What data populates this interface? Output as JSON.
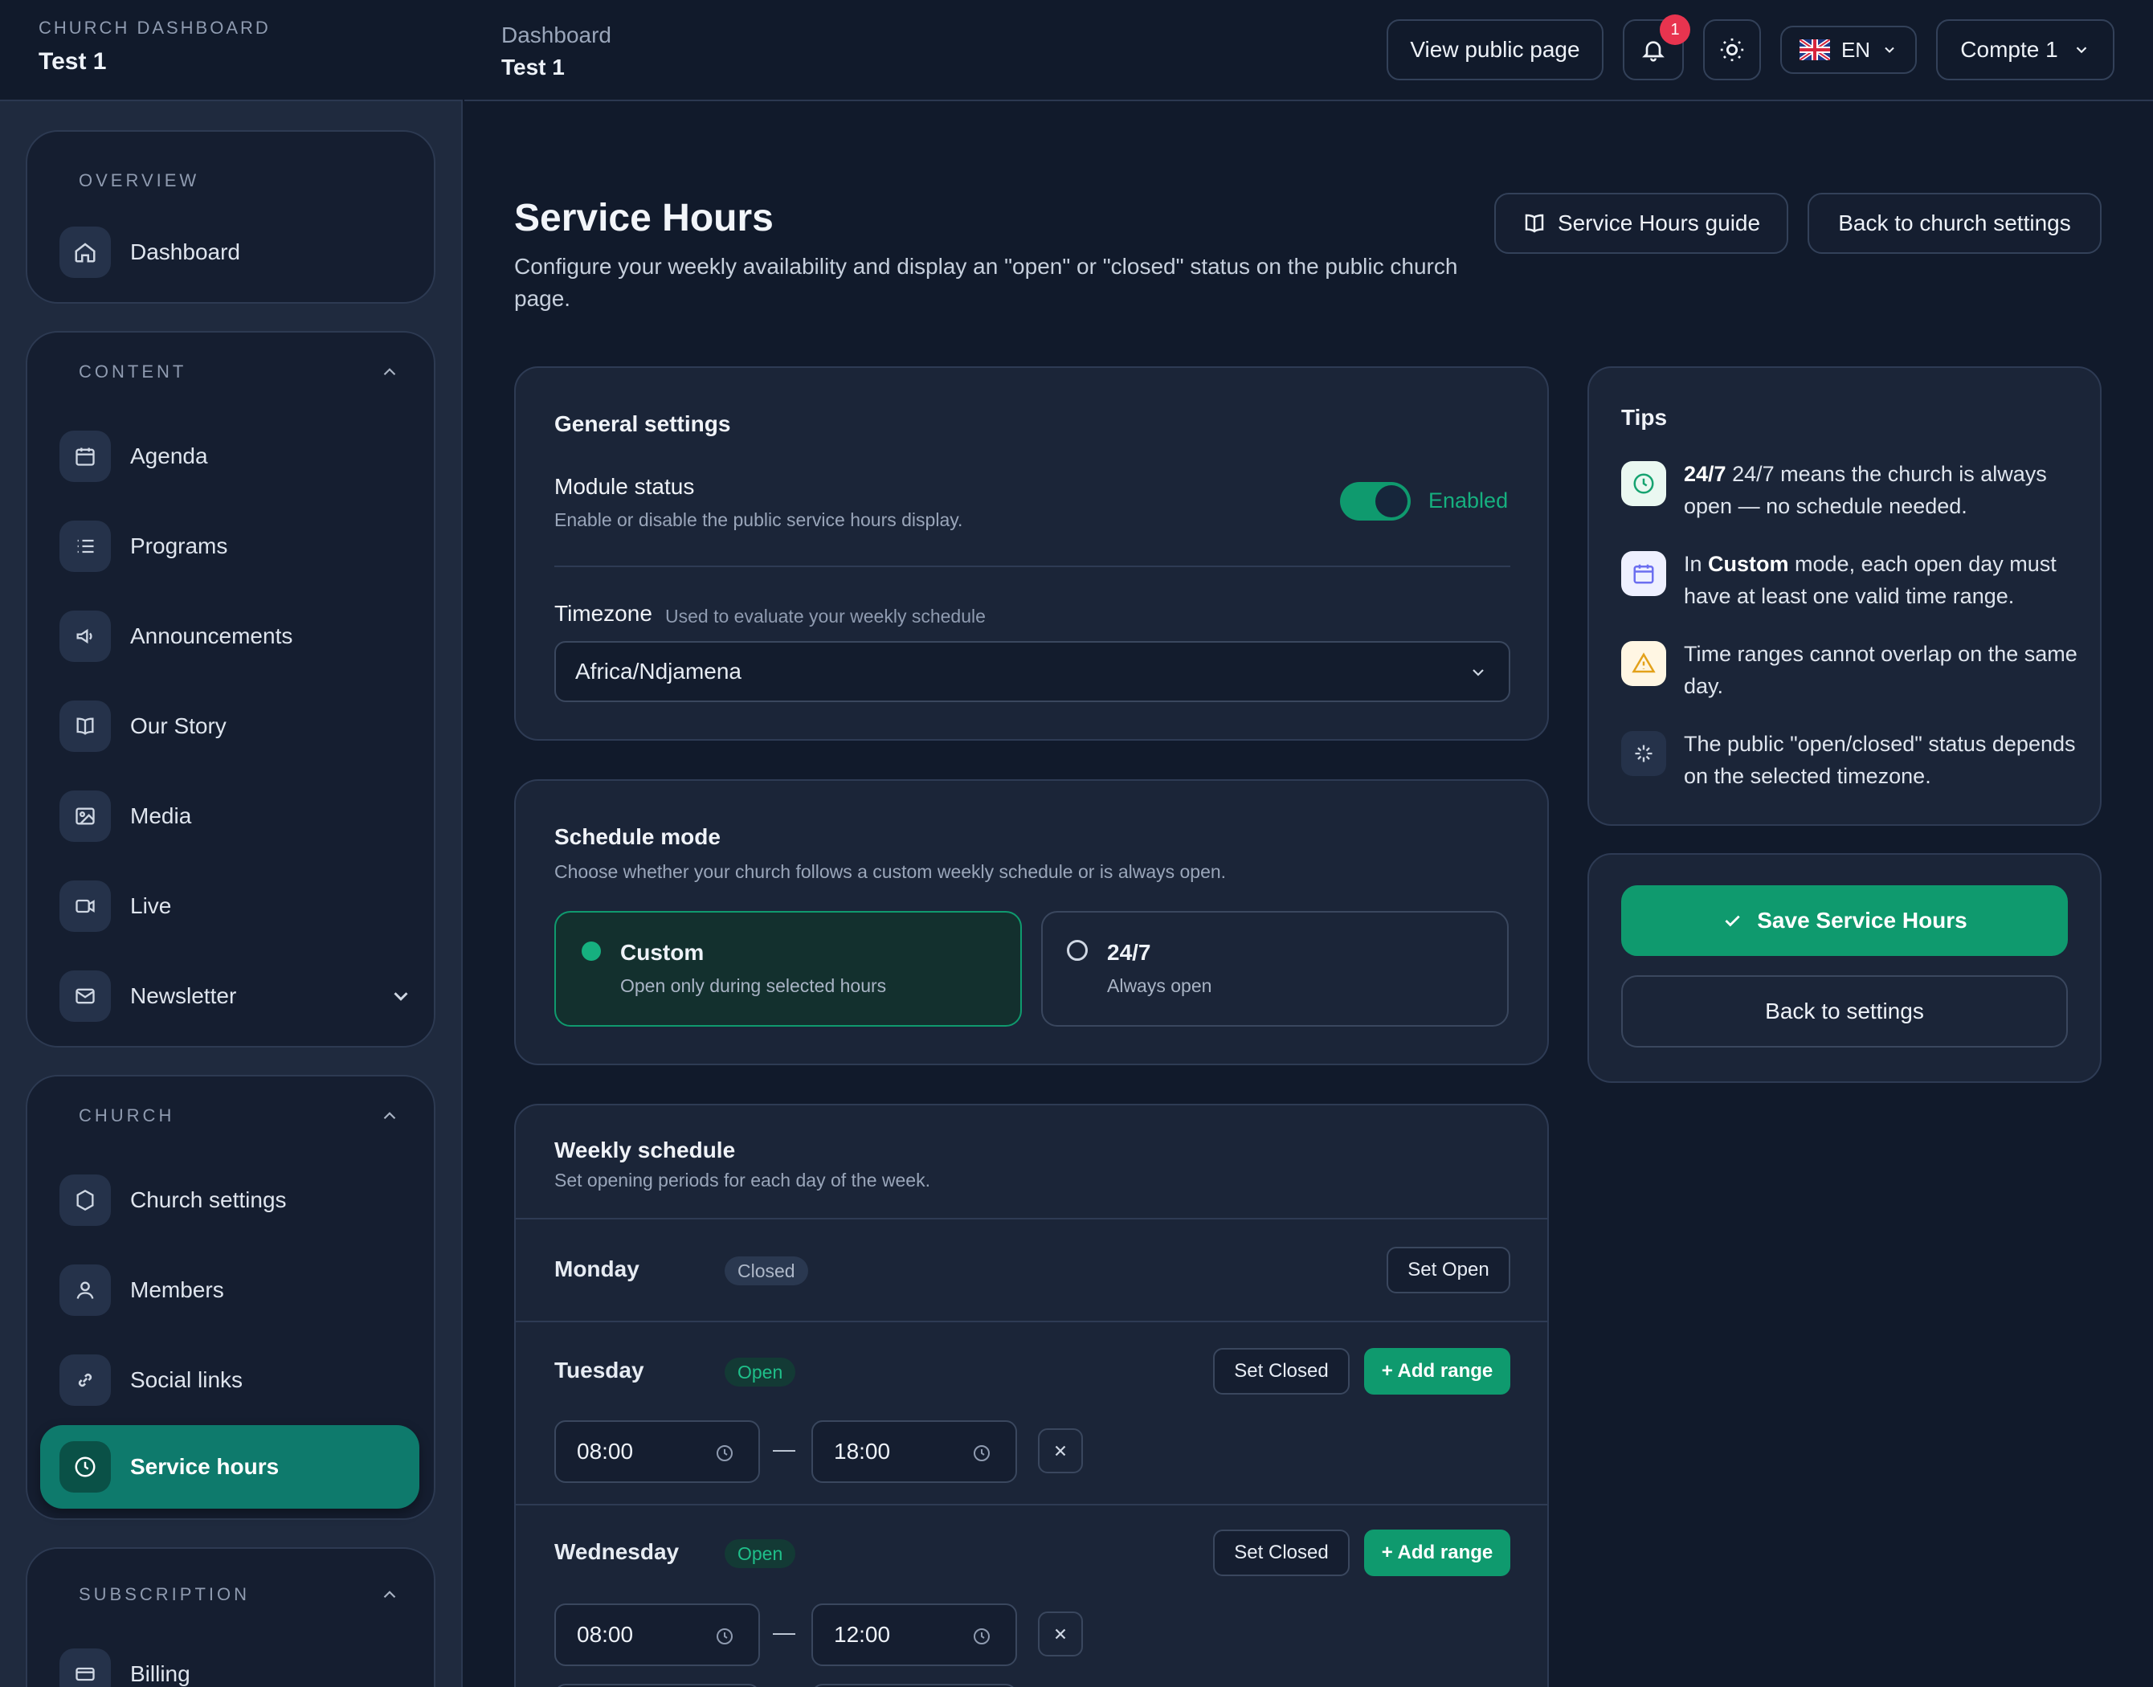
{
  "brand": {
    "kicker": "CHURCH DASHBOARD",
    "name": "Test 1"
  },
  "sidebar": {
    "overview": {
      "title": "OVERVIEW",
      "items": [
        {
          "label": "Dashboard",
          "icon": "home-icon"
        }
      ]
    },
    "content": {
      "title": "CONTENT",
      "items": [
        {
          "label": "Agenda",
          "icon": "calendar-icon"
        },
        {
          "label": "Programs",
          "icon": "list-icon"
        },
        {
          "label": "Announcements",
          "icon": "megaphone-icon"
        },
        {
          "label": "Our Story",
          "icon": "book-icon"
        },
        {
          "label": "Media",
          "icon": "image-icon"
        },
        {
          "label": "Live",
          "icon": "video-icon"
        },
        {
          "label": "Newsletter",
          "icon": "mail-icon"
        }
      ]
    },
    "church": {
      "title": "CHURCH",
      "items": [
        {
          "label": "Church settings",
          "icon": "hexagon-icon"
        },
        {
          "label": "Members",
          "icon": "user-icon"
        },
        {
          "label": "Social links",
          "icon": "link-icon"
        },
        {
          "label": "Service hours",
          "icon": "clock-icon",
          "active": true
        }
      ]
    },
    "subscription": {
      "title": "SUBSCRIPTION",
      "items": [
        {
          "label": "Billing",
          "icon": "card-icon"
        }
      ]
    }
  },
  "topbar": {
    "crumb": "Dashboard",
    "page": "Test 1",
    "view_public": "View public page",
    "notifications": "1",
    "language": "EN",
    "account": "Compte 1"
  },
  "page": {
    "title": "Service Hours",
    "subtitle": "Configure your weekly availability and display an \"open\" or \"closed\" status on the public church page.",
    "guide_button": "Service Hours guide",
    "back_button": "Back to church settings"
  },
  "general": {
    "title": "General settings",
    "module_label": "Module status",
    "module_desc": "Enable or disable the public service hours display.",
    "module_state": "Enabled",
    "timezone_label": "Timezone",
    "timezone_hint": "Used to evaluate your weekly schedule",
    "timezone_value": "Africa/Ndjamena"
  },
  "mode": {
    "title": "Schedule mode",
    "desc": "Choose whether your church follows a custom weekly schedule or is always open.",
    "options": [
      {
        "label": "Custom",
        "desc": "Open only during selected hours",
        "selected": true
      },
      {
        "label": "24/7",
        "desc": "Always open",
        "selected": false
      }
    ]
  },
  "weekly": {
    "title": "Weekly schedule",
    "desc": "Set opening periods for each day of the week.",
    "set_open": "Set Open",
    "set_closed": "Set Closed",
    "add_range": "+ Add range",
    "separator": "—",
    "days": [
      {
        "name": "Monday",
        "status": "Closed",
        "ranges": []
      },
      {
        "name": "Tuesday",
        "status": "Open",
        "ranges": [
          {
            "start": "08:00",
            "end": "18:00"
          }
        ]
      },
      {
        "name": "Wednesday",
        "status": "Open",
        "ranges": [
          {
            "start": "08:00",
            "end": "12:00"
          }
        ]
      }
    ]
  },
  "tips": {
    "title": "Tips",
    "items": [
      {
        "bold": "24/7",
        "text": " 24/7 means the church is always open — no schedule needed.",
        "icon": "clock-icon"
      },
      {
        "pre": "In ",
        "bold": "Custom",
        "text": " mode, each open day must have at least one valid time range.",
        "icon": "calendar-icon"
      },
      {
        "text": "Time ranges cannot overlap on the same day.",
        "icon": "warning-icon"
      },
      {
        "text": "The public \"open/closed\" status depends on the selected timezone.",
        "icon": "sparkle-icon"
      }
    ]
  },
  "actions": {
    "save": "Save Service Hours",
    "back": "Back to settings"
  },
  "colors": {
    "accent": "#0f9a6e",
    "active_nav": "#0e7a6c",
    "background": "#111a2b",
    "card": "#1b2538"
  }
}
